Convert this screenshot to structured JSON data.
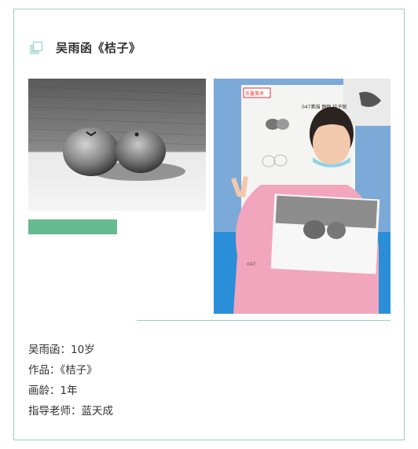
{
  "title": "吴雨函《桔子》",
  "accent_color": "#66bb8e",
  "border_color": "#9fc9c9",
  "photo_left": {
    "alt": "pencil sketch of two oranges"
  },
  "photo_right": {
    "alt": "girl holding drawing",
    "board_text": "047素描 静物 桔子图",
    "logo_text": "乐童美术",
    "paper_number": "047"
  },
  "info": [
    "吴雨函：10岁",
    "作品：《桔子》",
    "画龄：1年",
    "指导老师：蓝天成"
  ]
}
